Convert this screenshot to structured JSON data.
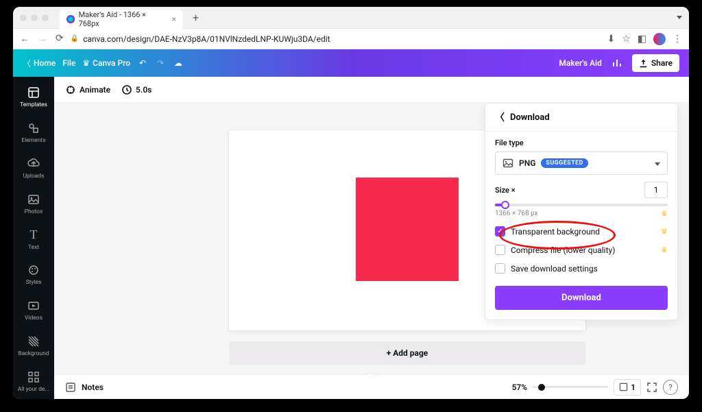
{
  "browser": {
    "tab_title": "Maker's Aid - 1366 × 768px",
    "url": "canva.com/design/DAE-NzV3p8A/01NVlNzdedLNP-KUWju3DA/edit"
  },
  "header": {
    "home": "Home",
    "file": "File",
    "canva_pro": "Canva Pro",
    "project_name": "Maker's Aid",
    "share": "Share"
  },
  "sidebar": {
    "items": [
      {
        "label": "Templates"
      },
      {
        "label": "Elements"
      },
      {
        "label": "Uploads"
      },
      {
        "label": "Photos"
      },
      {
        "label": "Text"
      },
      {
        "label": "Styles"
      },
      {
        "label": "Videos"
      },
      {
        "label": "Background"
      },
      {
        "label": "All your de..."
      }
    ]
  },
  "toolbar": {
    "animate": "Animate",
    "duration": "5.0s"
  },
  "canvas": {
    "add_page": "+ Add page"
  },
  "download": {
    "title": "Download",
    "file_type_label": "File type",
    "file_type_value": "PNG",
    "suggested": "SUGGESTED",
    "size_label": "Size ×",
    "size_value": "1",
    "dimensions": "1366 × 768 px",
    "transparent": "Transparent background",
    "compress": "Compress file (lower quality)",
    "save_settings": "Save download settings",
    "button": "Download"
  },
  "bottom": {
    "notes": "Notes",
    "zoom": "57%",
    "page_count": "1"
  }
}
